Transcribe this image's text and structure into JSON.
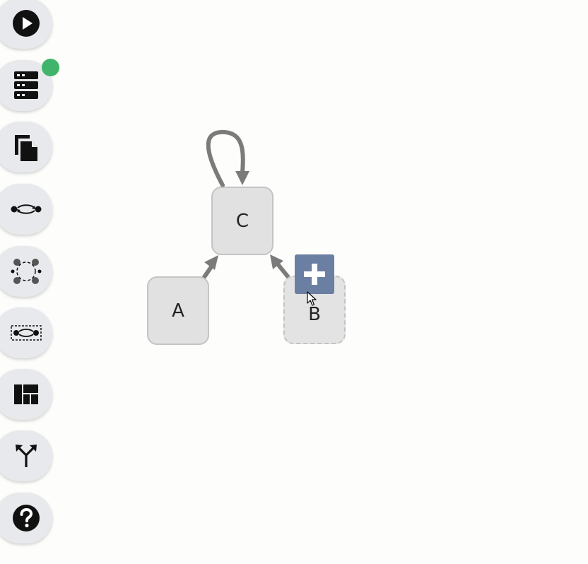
{
  "toolbar": {
    "items": [
      {
        "name": "run-button",
        "icon": "play-icon"
      },
      {
        "name": "database-button",
        "icon": "server-stack-icon",
        "status": "connected",
        "status_color": "#3fb46a"
      },
      {
        "name": "copy-button",
        "icon": "copy-files-icon"
      },
      {
        "name": "edge-mode-button",
        "icon": "edge-connect-icon"
      },
      {
        "name": "cycle-layout-button",
        "icon": "cycle-graph-icon"
      },
      {
        "name": "selection-edge-button",
        "icon": "selection-edge-icon"
      },
      {
        "name": "dashboard-layout-button",
        "icon": "dashboard-grid-icon"
      },
      {
        "name": "merge-split-button",
        "icon": "merge-split-icon"
      },
      {
        "name": "help-button",
        "icon": "help-icon"
      }
    ]
  },
  "graph": {
    "nodes": [
      {
        "id": "C",
        "label": "C"
      },
      {
        "id": "A",
        "label": "A"
      },
      {
        "id": "B",
        "label": "B",
        "state": "pending"
      }
    ],
    "edges": [
      {
        "from": "C",
        "to": "C"
      },
      {
        "from": "A",
        "to": "C"
      },
      {
        "from": "B",
        "to": "C"
      }
    ],
    "add_button": {
      "icon": "plus-icon",
      "color": "#6b7fa3"
    }
  }
}
